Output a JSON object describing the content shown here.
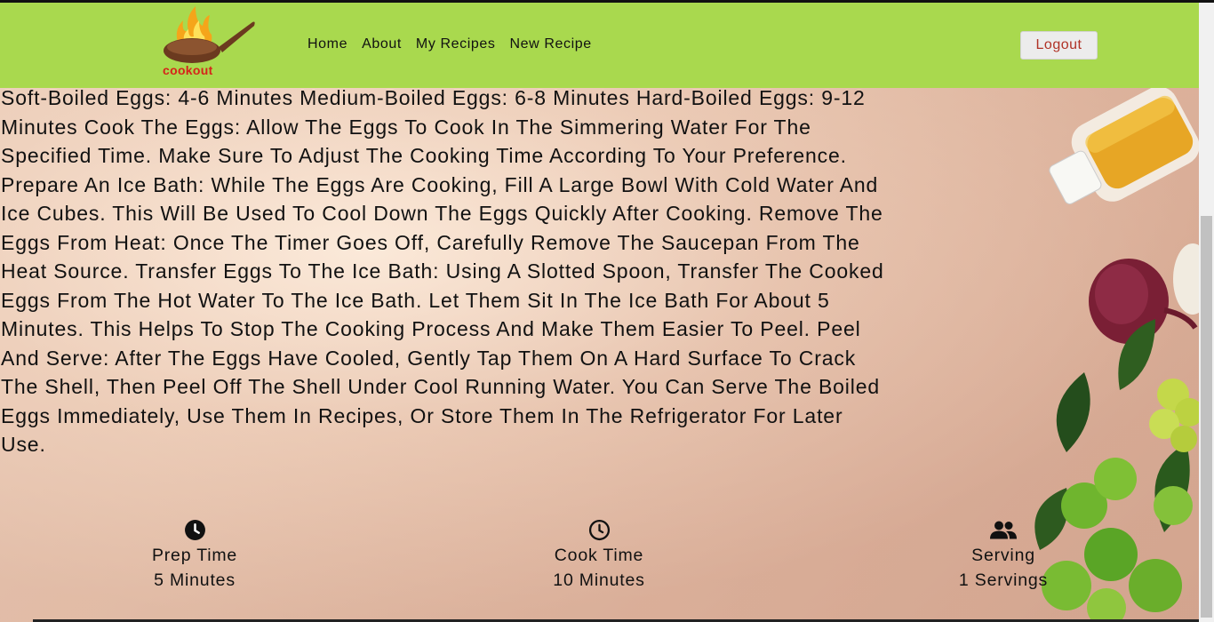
{
  "brand": {
    "logo_text": "cookout"
  },
  "nav": {
    "items": [
      "Home",
      "About",
      "My Recipes",
      "New Recipe"
    ]
  },
  "header": {
    "logout_label": "Logout"
  },
  "recipe": {
    "instructions": "Soft-Boiled Eggs: 4-6 Minutes Medium-Boiled Eggs: 6-8 Minutes Hard-Boiled Eggs: 9-12 Minutes Cook The Eggs: Allow The Eggs To Cook In The Simmering Water For The Specified Time. Make Sure To Adjust The Cooking Time According To Your Preference. Prepare An Ice Bath: While The Eggs Are Cooking, Fill A Large Bowl With Cold Water And Ice Cubes. This Will Be Used To Cool Down The Eggs Quickly After Cooking. Remove The Eggs From Heat: Once The Timer Goes Off, Carefully Remove The Saucepan From The Heat Source. Transfer Eggs To The Ice Bath: Using A Slotted Spoon, Transfer The Cooked Eggs From The Hot Water To The Ice Bath. Let Them Sit In The Ice Bath For About 5 Minutes. This Helps To Stop The Cooking Process And Make Them Easier To Peel. Peel And Serve: After The Eggs Have Cooled, Gently Tap Them On A Hard Surface To Crack The Shell, Then Peel Off The Shell Under Cool Running Water. You Can Serve The Boiled Eggs Immediately, Use Them In Recipes, Or Store Them In The Refrigerator For Later Use.",
    "prep": {
      "label": "Prep Time",
      "value": "5 Minutes",
      "icon": "clock-solid-icon"
    },
    "cook": {
      "label": "Cook Time",
      "value": "10 Minutes",
      "icon": "clock-outline-icon"
    },
    "serving": {
      "label": "Serving",
      "value": "1 Servings",
      "icon": "users-icon"
    }
  },
  "colors": {
    "header_bg": "#a9d94e",
    "logout_text": "#b03226",
    "logo_text": "#d6241a"
  }
}
